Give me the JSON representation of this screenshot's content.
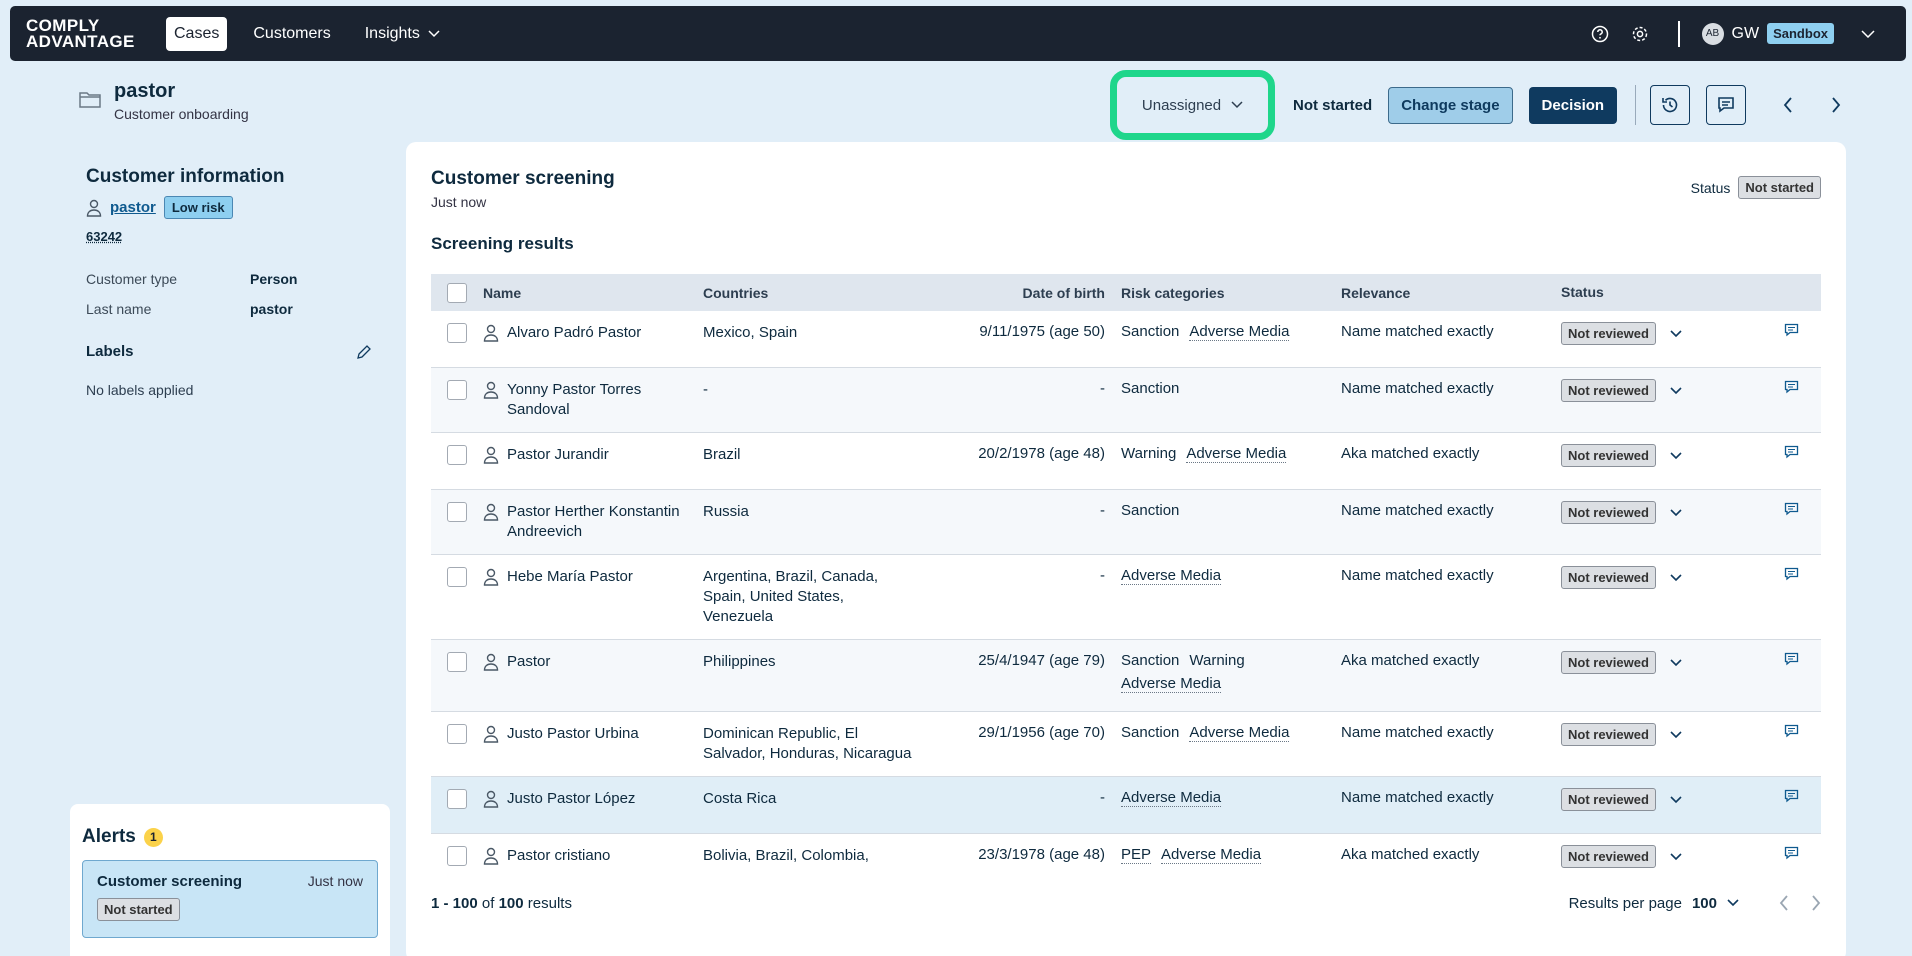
{
  "nav": {
    "logo_line1": "COMPLY",
    "logo_line2": "ADVANTAGE",
    "tabs": [
      {
        "label": "Cases"
      },
      {
        "label": "Customers"
      },
      {
        "label": "Insights"
      }
    ],
    "user_avatar": "AB",
    "user_initials": "GW",
    "env_badge": "Sandbox"
  },
  "case": {
    "title": "pastor",
    "subtitle": "Customer onboarding",
    "assignee": "Unassigned",
    "stage": "Not started",
    "change_stage_label": "Change stage",
    "decision_label": "Decision"
  },
  "customer": {
    "heading": "Customer information",
    "name": "pastor",
    "risk": "Low risk",
    "id": "63242",
    "fields": [
      {
        "key": "Customer type",
        "value": "Person"
      },
      {
        "key": "Last name",
        "value": "pastor"
      }
    ],
    "labels_heading": "Labels",
    "labels_empty": "No labels applied"
  },
  "alerts": {
    "heading": "Alerts",
    "count": "1",
    "card_title": "Customer screening",
    "card_time": "Just now",
    "card_status": "Not started"
  },
  "screening": {
    "title": "Customer screening",
    "time": "Just now",
    "status_label": "Status",
    "status_value": "Not started",
    "results_title": "Screening results",
    "columns": [
      "Name",
      "Countries",
      "Date of birth",
      "Risk categories",
      "Relevance",
      "Status"
    ],
    "rows": [
      {
        "name": "Alvaro Padró Pastor",
        "countries": "Mexico, Spain",
        "dob": "9/11/1975 (age 50)",
        "risk": [
          "Sanction",
          "Adverse Media"
        ],
        "relevance": "Name matched exactly",
        "status": "Not reviewed"
      },
      {
        "name": "Yonny Pastor Torres Sandoval",
        "countries": "-",
        "dob": "-",
        "risk": [
          "Sanction"
        ],
        "relevance": "Name matched exactly",
        "status": "Not reviewed"
      },
      {
        "name": "Pastor Jurandir",
        "countries": "Brazil",
        "dob": "20/2/1978 (age 48)",
        "risk": [
          "Warning",
          "Adverse Media"
        ],
        "relevance": "Aka matched exactly",
        "status": "Not reviewed"
      },
      {
        "name": "Pastor Herther Konstantin Andreevich",
        "countries": "Russia",
        "dob": "-",
        "risk": [
          "Sanction"
        ],
        "relevance": "Name matched exactly",
        "status": "Not reviewed"
      },
      {
        "name": "Hebe María Pastor",
        "countries": "Argentina, Brazil, Canada, Spain, United States, Venezuela",
        "dob": "-",
        "risk": [
          "Adverse Media"
        ],
        "relevance": "Name matched exactly",
        "status": "Not reviewed"
      },
      {
        "name": "Pastor",
        "countries": "Philippines",
        "dob": "25/4/1947 (age 79)",
        "risk": [
          "Sanction",
          "Warning",
          "Adverse Media"
        ],
        "relevance": "Aka matched exactly",
        "status": "Not reviewed"
      },
      {
        "name": "Justo Pastor Urbina",
        "countries": "Dominican Republic, El Salvador, Honduras, Nicaragua",
        "dob": "29/1/1956 (age 70)",
        "risk": [
          "Sanction",
          "Adverse Media"
        ],
        "relevance": "Name matched exactly",
        "status": "Not reviewed"
      },
      {
        "name": "Justo Pastor López",
        "countries": "Costa Rica",
        "dob": "-",
        "risk": [
          "Adverse Media"
        ],
        "relevance": "Name matched exactly",
        "status": "Not reviewed"
      },
      {
        "name": "Pastor cristiano",
        "countries": "Bolivia, Brazil, Colombia,",
        "dob": "23/3/1978 (age 48)",
        "risk": [
          "PEP",
          "Adverse Media"
        ],
        "relevance": "Aka matched exactly",
        "status": "Not reviewed"
      }
    ],
    "range": "1 - 100",
    "of_text": "of",
    "total": "100",
    "results_word": "results",
    "rpp_label": "Results per page",
    "rpp_value": "100"
  }
}
